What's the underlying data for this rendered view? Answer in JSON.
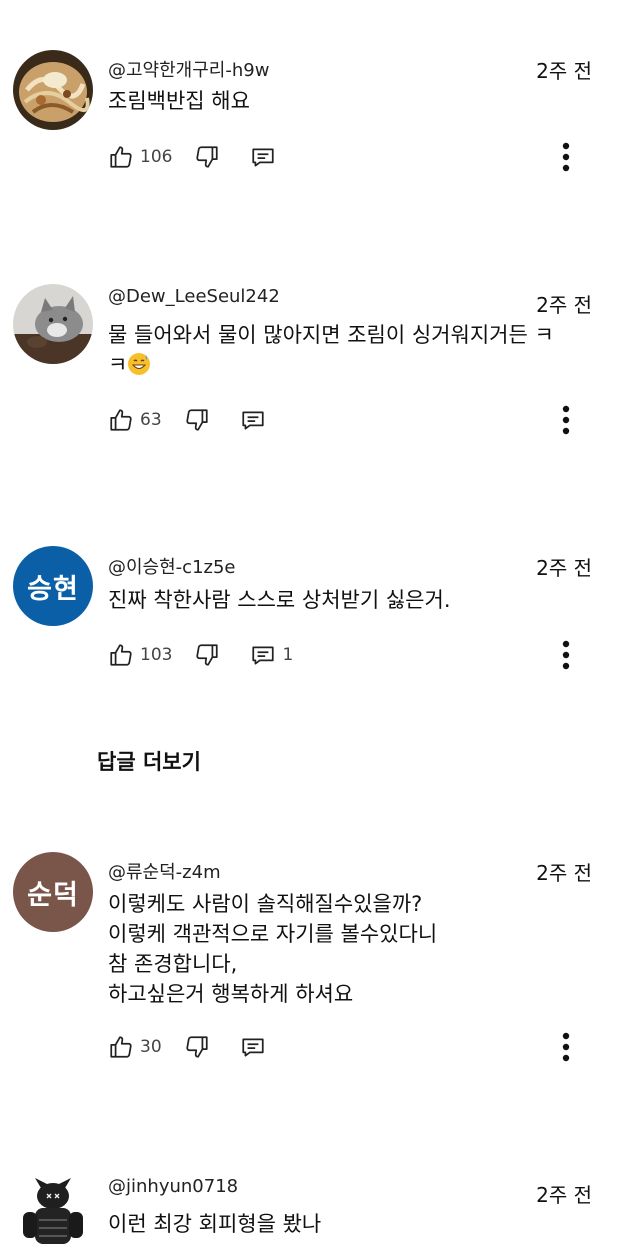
{
  "comments": [
    {
      "author": "@고약한개구리-h9w",
      "time": "2주 전",
      "lines": [
        "조림백반집 해요"
      ],
      "likes": "106",
      "replies": "",
      "avatar": {
        "type": "photo",
        "icon": "food-photo"
      }
    },
    {
      "author": "@Dew_LeeSeul242",
      "time": "2주 전",
      "lines": [
        "물 들어와서 물이 많아지면 조림이 싱거워지거든 ㅋ",
        "ㅋ"
      ],
      "emoji": "grinning-sweat-emoji",
      "likes": "63",
      "replies": "",
      "avatar": {
        "type": "photo",
        "icon": "cat-photo"
      }
    },
    {
      "author": "@이승현-c1z5e",
      "time": "2주 전",
      "lines": [
        "진짜 착한사람 스스로 상처받기 싫은거."
      ],
      "likes": "103",
      "replies": "1",
      "avatar": {
        "type": "initials",
        "text": "승현",
        "color": "#0a5fa6"
      }
    },
    {
      "author": "@류순덕-z4m",
      "time": "2주 전",
      "lines": [
        "이렇케도 사람이 솔직해질수있을까?",
        "이렇케 객관적으로 자기를 볼수있다니",
        "참 존경합니다,",
        "하고싶은거 행복하게 하셔요"
      ],
      "likes": "30",
      "replies": "",
      "avatar": {
        "type": "initials",
        "text": "순덕",
        "color": "#79554a"
      }
    },
    {
      "author": "@jinhyun0718",
      "time": "2주 전",
      "lines": [
        "이런 최강 회피형을 봤나"
      ],
      "likes": "",
      "replies": "",
      "avatar": {
        "type": "photo",
        "icon": "figure-photo"
      }
    }
  ],
  "more_replies_label": "답글 더보기"
}
